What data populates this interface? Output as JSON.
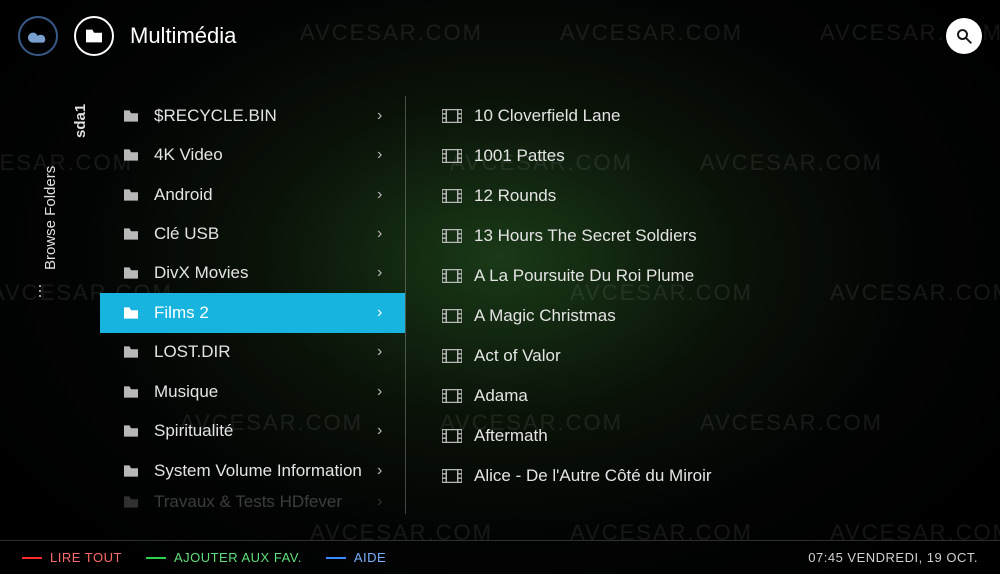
{
  "header": {
    "title": "Multimédia"
  },
  "sidebar": {
    "breadcrumb_root": "Browse Folders",
    "device": "sda1"
  },
  "folders": [
    {
      "label": "$RECYCLE.BIN",
      "selected": false
    },
    {
      "label": "4K Video",
      "selected": false
    },
    {
      "label": "Android",
      "selected": false
    },
    {
      "label": "Clé USB",
      "selected": false
    },
    {
      "label": "DivX Movies",
      "selected": false
    },
    {
      "label": "Films 2",
      "selected": true
    },
    {
      "label": "LOST.DIR",
      "selected": false
    },
    {
      "label": "Musique",
      "selected": false
    },
    {
      "label": "Spiritualité",
      "selected": false
    },
    {
      "label": "System Volume Information",
      "selected": false
    },
    {
      "label": "Travaux & Tests HDfever",
      "selected": false,
      "cutoff": true
    }
  ],
  "files": [
    {
      "label": "10 Cloverfield Lane"
    },
    {
      "label": "1001 Pattes"
    },
    {
      "label": "12 Rounds"
    },
    {
      "label": "13 Hours The Secret Soldiers"
    },
    {
      "label": "A La Poursuite Du Roi Plume"
    },
    {
      "label": "A Magic Christmas"
    },
    {
      "label": "Act of Valor"
    },
    {
      "label": "Adama"
    },
    {
      "label": "Aftermath"
    },
    {
      "label": "Alice - De l'Autre Côté du Miroir"
    }
  ],
  "footer": {
    "red": "LIRE TOUT",
    "green": "AJOUTER AUX FAV.",
    "blue": "AIDE",
    "clock": "07:45 VENDREDI, 19 OCT."
  },
  "watermark": "AVCESAR.COM"
}
